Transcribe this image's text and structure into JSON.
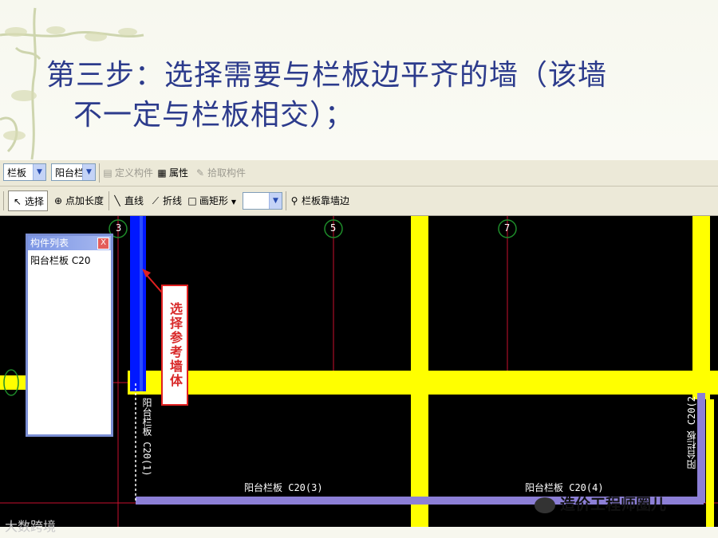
{
  "slide": {
    "heading_line1": "第三步：选择需要与栏板边平齐的墙（该墙",
    "heading_line2": "不一定与栏板相交）；"
  },
  "toolbar1": {
    "type_combo": "栏板",
    "name_combo": "阳台栏",
    "define_label": "定义构件",
    "props_label": "属性",
    "pick_label": "拾取构件"
  },
  "toolbar2": {
    "select_label": "选择",
    "point_len_label": "点加长度",
    "line_label": "直线",
    "polyline_label": "折线",
    "rect_label": "画矩形",
    "rect_combo": "",
    "align_label": "栏板靠墙边"
  },
  "panel": {
    "title": "构件列表",
    "close": "X",
    "item": "阳台栏板 C20"
  },
  "axes": [
    "3",
    "5",
    "7"
  ],
  "callout": "选择参考墙体",
  "labels": {
    "label1": "阳台栏板 C20(1)",
    "label2": "阳台栏板 C20(2",
    "label3": "阳台栏板 C20(3)",
    "label4": "阳台栏板 C20(4)"
  },
  "watermark": "造价工程师圈儿",
  "source": "大数跨境",
  "colors": {
    "heading": "#2c3b8c",
    "wall": "#ffff00",
    "selected_wall": "#0000ff",
    "rail": "#8c7fd6",
    "axis": "#c8102e"
  }
}
